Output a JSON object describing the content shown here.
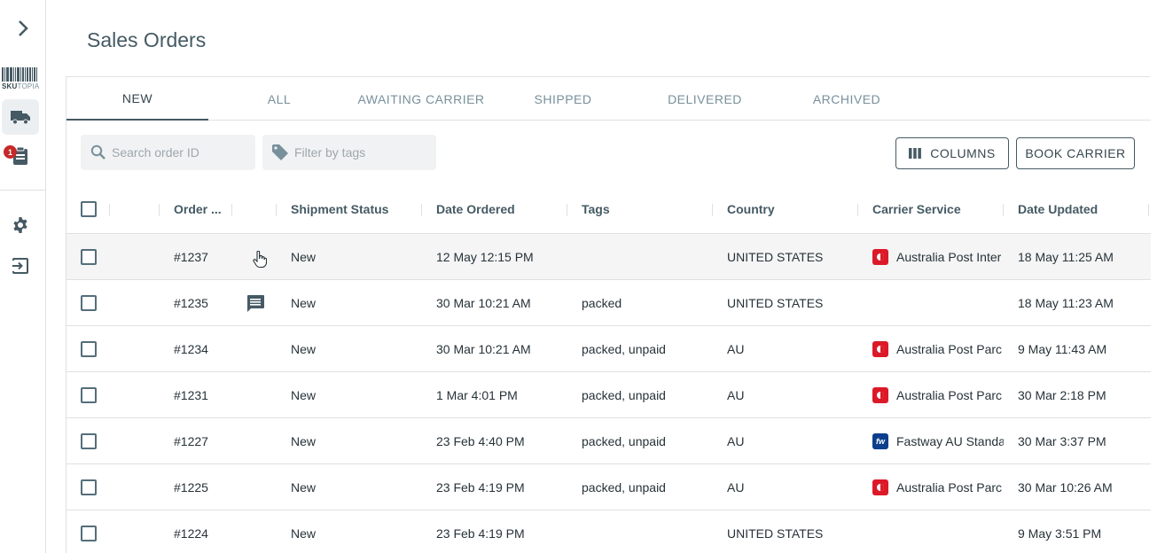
{
  "sidebar": {
    "logo_bold": "SKU",
    "logo_light": "TOPIA",
    "badge_count": "1",
    "items": [
      {
        "name": "shipments",
        "icon": "truck-icon",
        "active": true
      },
      {
        "name": "orders",
        "icon": "clipboard-icon",
        "active": false
      },
      {
        "name": "settings",
        "icon": "gear-icon",
        "active": false
      },
      {
        "name": "logout",
        "icon": "logout-icon",
        "active": false
      }
    ]
  },
  "page": {
    "title": "Sales Orders"
  },
  "tabs": [
    {
      "label": "NEW",
      "active": true
    },
    {
      "label": "ALL",
      "active": false
    },
    {
      "label": "AWAITING CARRIER",
      "active": false
    },
    {
      "label": "SHIPPED",
      "active": false
    },
    {
      "label": "DELIVERED",
      "active": false
    },
    {
      "label": "ARCHIVED",
      "active": false
    }
  ],
  "toolbar": {
    "search_placeholder": "Search order ID",
    "tags_placeholder": "Filter by tags",
    "columns_label": "COLUMNS",
    "book_carrier_label": "BOOK CARRIER"
  },
  "table": {
    "headers": {
      "order": "Order ...",
      "status": "Shipment Status",
      "date_ordered": "Date Ordered",
      "tags": "Tags",
      "country": "Country",
      "carrier": "Carrier Service",
      "date_updated": "Date Updated"
    },
    "rows": [
      {
        "order": "#1237",
        "note": false,
        "status": "New",
        "date_ordered": "12 May 12:15 PM",
        "tags": "",
        "country": "UNITED STATES",
        "carrier_logo": "auspost",
        "carrier": "Australia Post Inter",
        "date_updated": "18 May 11:25 AM"
      },
      {
        "order": "#1235",
        "note": true,
        "status": "New",
        "date_ordered": "30 Mar 10:21 AM",
        "tags": "packed",
        "country": "UNITED STATES",
        "carrier_logo": "",
        "carrier": "",
        "date_updated": "18 May 11:23 AM"
      },
      {
        "order": "#1234",
        "note": false,
        "status": "New",
        "date_ordered": "30 Mar 10:21 AM",
        "tags": "packed, unpaid",
        "country": "AU",
        "carrier_logo": "auspost",
        "carrier": "Australia Post Parc",
        "date_updated": "9 May 11:43 AM"
      },
      {
        "order": "#1231",
        "note": false,
        "status": "New",
        "date_ordered": "1 Mar 4:01 PM",
        "tags": "packed, unpaid",
        "country": "AU",
        "carrier_logo": "auspost",
        "carrier": "Australia Post Parc",
        "date_updated": "30 Mar 2:18 PM"
      },
      {
        "order": "#1227",
        "note": false,
        "status": "New",
        "date_ordered": "23 Feb 4:40 PM",
        "tags": "packed, unpaid",
        "country": "AU",
        "carrier_logo": "fastway",
        "carrier": "Fastway AU Standa",
        "date_updated": "30 Mar 3:37 PM"
      },
      {
        "order": "#1225",
        "note": false,
        "status": "New",
        "date_ordered": "23 Feb 4:19 PM",
        "tags": "packed, unpaid",
        "country": "AU",
        "carrier_logo": "auspost",
        "carrier": "Australia Post Parc",
        "date_updated": "30 Mar 10:26 AM"
      },
      {
        "order": "#1224",
        "note": false,
        "status": "New",
        "date_ordered": "23 Feb 4:19 PM",
        "tags": "",
        "country": "UNITED STATES",
        "carrier_logo": "",
        "carrier": "",
        "date_updated": "9 May 3:51 PM"
      }
    ]
  },
  "colors": {
    "primary": "#455a64",
    "auspost_red": "#dc1928",
    "fastway_blue": "#0b3e8c",
    "badge_red": "#c62828"
  }
}
